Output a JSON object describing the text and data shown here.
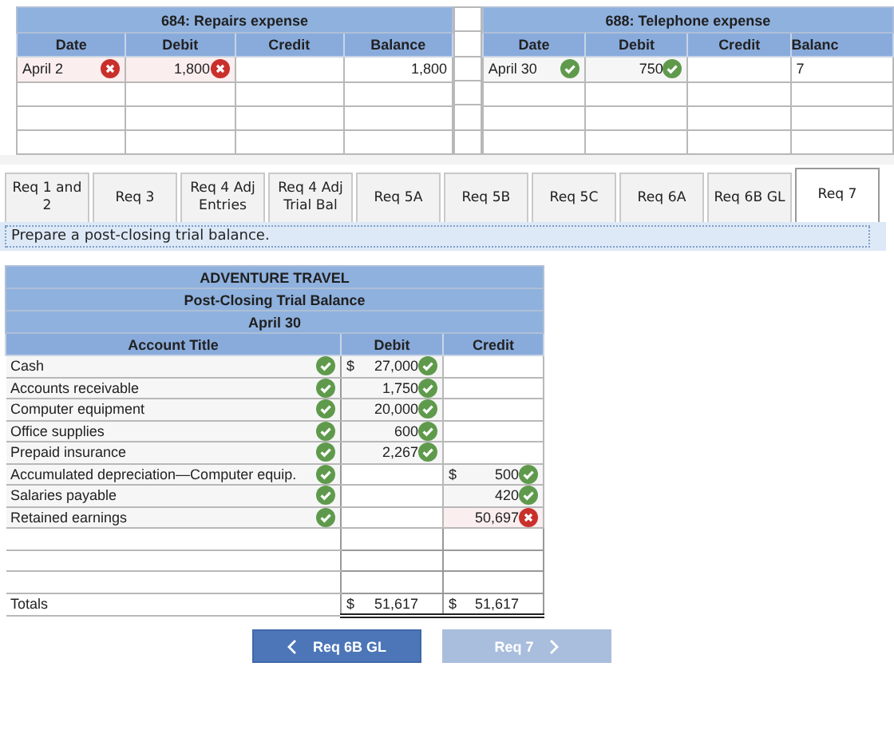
{
  "ledgers": [
    {
      "title": "684: Repairs expense",
      "columns": [
        "Date",
        "Debit",
        "Credit",
        "Balance"
      ],
      "rows": [
        {
          "date": "April 2",
          "date_ok": false,
          "debit": "1,800",
          "debit_ok": false,
          "balance": "1,800"
        }
      ]
    },
    {
      "title": "688: Telephone expense",
      "columns": [
        "Date",
        "Debit",
        "Credit",
        "Balanc"
      ],
      "rows": [
        {
          "date": "April 30",
          "date_ok": true,
          "debit": "750",
          "debit_ok": true,
          "balance": "7"
        }
      ]
    }
  ],
  "tabs": [
    {
      "label": "Req 1 and 2",
      "selected": false
    },
    {
      "label": "Req 3",
      "selected": false
    },
    {
      "label": "Req 4 Adj Entries",
      "selected": false
    },
    {
      "label": "Req 4 Adj Trial Bal",
      "selected": false
    },
    {
      "label": "Req 5A",
      "selected": false
    },
    {
      "label": "Req 5B",
      "selected": false
    },
    {
      "label": "Req 5C",
      "selected": false
    },
    {
      "label": "Req 6A",
      "selected": false
    },
    {
      "label": "Req 6B GL",
      "selected": false
    },
    {
      "label": "Req 7",
      "selected": true
    }
  ],
  "instruction": "Prepare a post-closing trial balance.",
  "trial_balance": {
    "company": "ADVENTURE TRAVEL",
    "title": "Post-Closing Trial Balance",
    "date": "April 30",
    "columns": [
      "Account Title",
      "Debit",
      "Credit"
    ],
    "rows": [
      {
        "account": "Cash",
        "account_ok": true,
        "debit_symbol": "$",
        "debit": "27,000",
        "debit_ok": true
      },
      {
        "account": "Accounts receivable",
        "account_ok": true,
        "debit": "1,750",
        "debit_ok": true
      },
      {
        "account": "Computer equipment",
        "account_ok": true,
        "debit": "20,000",
        "debit_ok": true
      },
      {
        "account": "Office supplies",
        "account_ok": true,
        "debit": "600",
        "debit_ok": true
      },
      {
        "account": "Prepaid insurance",
        "account_ok": true,
        "debit": "2,267",
        "debit_ok": true
      },
      {
        "account": "Accumulated depreciation—Computer equip.",
        "account_ok": true,
        "credit_symbol": "$",
        "credit": "500",
        "credit_ok": true
      },
      {
        "account": "Salaries payable",
        "account_ok": true,
        "credit": "420",
        "credit_ok": true
      },
      {
        "account": "Retained earnings",
        "account_ok": true,
        "credit": "50,697",
        "credit_ok": false
      }
    ],
    "totals": {
      "label": "Totals",
      "debit_symbol": "$",
      "debit": "51,617",
      "credit_symbol": "$",
      "credit": "51,617"
    }
  },
  "buttons": [
    {
      "kind": "prev",
      "label": "Req 6B GL",
      "disabled": false
    },
    {
      "kind": "next",
      "label": "Req 7",
      "disabled": true
    }
  ]
}
